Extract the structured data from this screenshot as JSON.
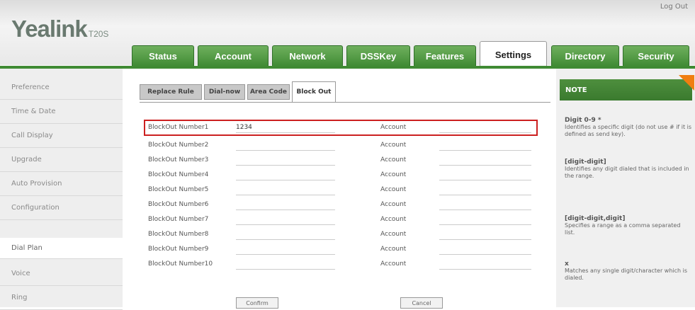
{
  "header": {
    "logo": "Yealink",
    "model": "T20S",
    "logout": "Log Out"
  },
  "tabs": [
    {
      "label": "Status",
      "active": false
    },
    {
      "label": "Account",
      "active": false
    },
    {
      "label": "Network",
      "active": false
    },
    {
      "label": "DSSKey",
      "active": false
    },
    {
      "label": "Features",
      "active": false
    },
    {
      "label": "Settings",
      "active": true
    },
    {
      "label": "Directory",
      "active": false
    },
    {
      "label": "Security",
      "active": false
    }
  ],
  "sidebar": {
    "items": [
      {
        "label": "Preference",
        "active": false
      },
      {
        "label": "Time & Date",
        "active": false
      },
      {
        "label": "Call Display",
        "active": false
      },
      {
        "label": "Upgrade",
        "active": false
      },
      {
        "label": "Auto Provision",
        "active": false
      },
      {
        "label": "Configuration",
        "active": false
      },
      {
        "label": "Dial Plan",
        "active": true
      },
      {
        "label": "Voice",
        "active": false
      },
      {
        "label": "Ring",
        "active": false
      }
    ]
  },
  "subtabs": [
    {
      "label": "Replace Rule",
      "active": false
    },
    {
      "label": "Dial-now",
      "active": false
    },
    {
      "label": "Area Code",
      "active": false
    },
    {
      "label": "Block Out",
      "active": true
    }
  ],
  "rows": [
    {
      "label": "BlockOut Number1",
      "value": "1234",
      "account_label": "Account",
      "account_value": ""
    },
    {
      "label": "BlockOut Number2",
      "value": "",
      "account_label": "Account",
      "account_value": ""
    },
    {
      "label": "BlockOut Number3",
      "value": "",
      "account_label": "Account",
      "account_value": ""
    },
    {
      "label": "BlockOut Number4",
      "value": "",
      "account_label": "Account",
      "account_value": ""
    },
    {
      "label": "BlockOut Number5",
      "value": "",
      "account_label": "Account",
      "account_value": ""
    },
    {
      "label": "BlockOut Number6",
      "value": "",
      "account_label": "Account",
      "account_value": ""
    },
    {
      "label": "BlockOut Number7",
      "value": "",
      "account_label": "Account",
      "account_value": ""
    },
    {
      "label": "BlockOut Number8",
      "value": "",
      "account_label": "Account",
      "account_value": ""
    },
    {
      "label": "BlockOut Number9",
      "value": "",
      "account_label": "Account",
      "account_value": ""
    },
    {
      "label": "BlockOut Number10",
      "value": "",
      "account_label": "Account",
      "account_value": ""
    }
  ],
  "buttons": {
    "confirm": "Confirm",
    "cancel": "Cancel"
  },
  "note": {
    "title": "NOTE",
    "blocks": [
      {
        "title": "Digit 0-9 *",
        "text": "Identifies a specific digit (do not use # if it is defined as send key)."
      },
      {
        "title": "[digit-digit]",
        "text": "Identifies any digit dialed that is included in the range."
      },
      {
        "title": "[digit-digit,digit]",
        "text": "Specifies a range as a comma separated list."
      },
      {
        "title": "x",
        "text": "Matches any single digit/character which is dialed."
      }
    ]
  },
  "colors": {
    "tab_green": "#3f8a33",
    "highlight_red": "#cc2020",
    "note_accent": "#f07e10"
  }
}
